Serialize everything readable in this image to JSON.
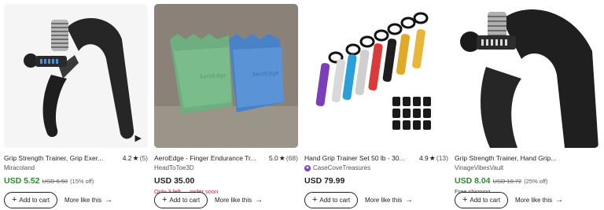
{
  "products": [
    {
      "title": "Grip Strength Trainer, Grip Exer...",
      "rating": "4.2",
      "reviews": "(5)",
      "shop": "Miracoland",
      "price": "USD 5.52",
      "price_sale": true,
      "original_price": "USD 6.50",
      "discount": "(15% off)",
      "note": "",
      "add_to_cart": "Add to cart",
      "more_like_this": "More like this",
      "has_video": true
    },
    {
      "title": "AeroEdge - Finger Endurance Tr...",
      "rating": "5.0",
      "reviews": "(68)",
      "shop": "HeadToToe3D",
      "price": "USD 35.00",
      "price_sale": false,
      "original_price": "",
      "discount": "",
      "note": "Only 3 left — order soon",
      "add_to_cart": "Add to cart",
      "more_like_this": "More like this",
      "has_video": false
    },
    {
      "title": "Hand Grip Trainer Set 50 lb - 30...",
      "rating": "4.9",
      "reviews": "(13)",
      "shop": "CaseCoveTreasures",
      "price": "USD 79.99",
      "price_sale": false,
      "original_price": "",
      "discount": "",
      "note": "",
      "add_to_cart": "Add to cart",
      "more_like_this": "More like this",
      "has_video": false
    },
    {
      "title": "Grip Strength Trainer, Hand Grip...",
      "rating": "",
      "reviews": "",
      "shop": "VinageVibesVault",
      "price": "USD 8.04",
      "price_sale": true,
      "original_price": "USD 10.72",
      "discount": "(25% off)",
      "note": "Free shipping",
      "add_to_cart": "Add to cart",
      "more_like_this": "More like this",
      "has_video": false
    }
  ],
  "colors": {
    "sale_price": "#2e8a2e",
    "low_stock": "#c4283c",
    "star_seller_badge": "#7b3fc4"
  },
  "icons": {
    "star": "star-icon",
    "play": "play-icon",
    "plus": "plus-icon",
    "arrow": "arrow-right-icon",
    "badge": "star-seller-badge-icon"
  }
}
